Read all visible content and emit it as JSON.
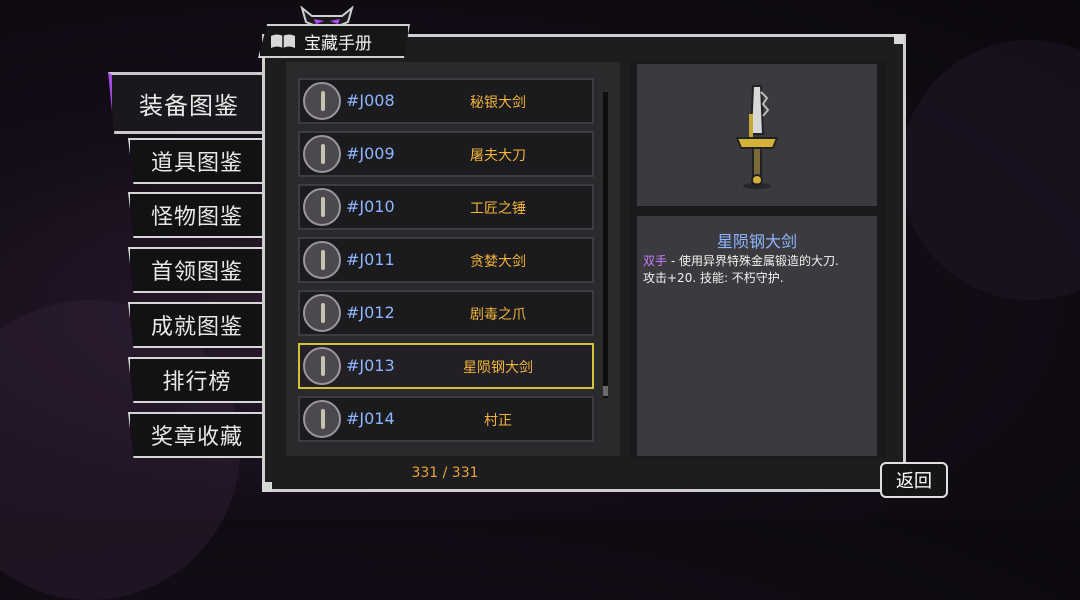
{
  "window": {
    "title": "宝藏手册"
  },
  "tabs": [
    {
      "label": "装备图鉴",
      "active": true
    },
    {
      "label": "道具图鉴"
    },
    {
      "label": "怪物图鉴"
    },
    {
      "label": "首领图鉴"
    },
    {
      "label": "成就图鉴"
    },
    {
      "label": "排行榜"
    },
    {
      "label": "奖章收藏"
    }
  ],
  "items": [
    {
      "code": "#J008",
      "name": "秘银大剑"
    },
    {
      "code": "#J009",
      "name": "屠夫大刀"
    },
    {
      "code": "#J010",
      "name": "工匠之锤"
    },
    {
      "code": "#J011",
      "name": "贪婪大剑"
    },
    {
      "code": "#J012",
      "name": "剧毒之爪"
    },
    {
      "code": "#J013",
      "name": "星陨钢大剑",
      "selected": true
    },
    {
      "code": "#J014",
      "name": "村正"
    }
  ],
  "count": "331 / 331",
  "detail": {
    "title": "星陨钢大剑",
    "tag": "双手",
    "line1": " - 使用异界特殊金属锻造的大刀.",
    "line2": "攻击+20. 技能: 不朽守护."
  },
  "back_label": "返回",
  "colors": {
    "accent": "#a14be0",
    "selected": "#d4c13a",
    "code": "#8fb6ff",
    "name": "#f0b43a"
  },
  "icons": {
    "title": "book-icon",
    "header": "demon-face-icon",
    "item": "sword-icon"
  }
}
